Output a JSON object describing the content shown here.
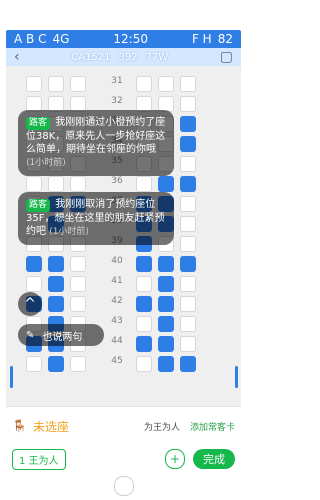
{
  "status_bar": {
    "left": "A B C",
    "middle": "4G",
    "time": "12:50",
    "right": "F H",
    "battery": "82"
  },
  "nav": {
    "flight_code": "CA1521",
    "flight_number": "392",
    "aircraft": "77W"
  },
  "seat_rows": [
    "31",
    "32",
    "33",
    "34",
    "35",
    "36",
    "37",
    "38",
    "39",
    "40",
    "41",
    "42",
    "43",
    "44",
    "45"
  ],
  "bubbles": [
    {
      "tag": "路客",
      "text": "我刚刚通过小橙预约了座位38K，原来先人一步抢好座这么简单，期待坐在邻座的你哦",
      "time": "(1小时前)"
    },
    {
      "tag": "路客",
      "text": "我刚刚取消了预约座位35F，想坐在这里的朋友赶紧预约吧",
      "time": "(1小时前)"
    }
  ],
  "buttons": {
    "talk": "也说两句"
  },
  "bottom": {
    "unselected": "未选座",
    "for_name": "为王为人",
    "add_frequent": "添加常客卡",
    "passenger_chip": "1 王为人",
    "done": "完成"
  },
  "colors": {
    "blue": "#2e7ee6",
    "green": "#16b84c",
    "orange": "#f0a11a"
  },
  "icons": {
    "back": "back-arrow-icon",
    "up": "chevron-up-icon",
    "edit": "pencil-icon",
    "seat_orange": "seat-icon",
    "plus": "plus-icon"
  }
}
